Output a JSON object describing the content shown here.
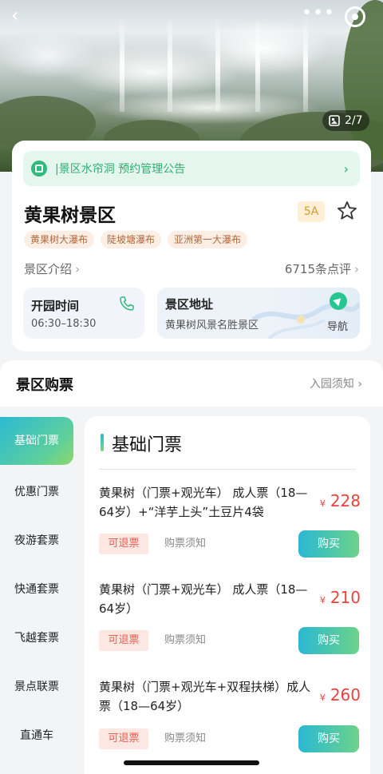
{
  "hero": {
    "photo_count": "2/7"
  },
  "info": {
    "notice": "|景区水帘洞 预约管理公告",
    "title": "黄果树景区",
    "level": "5A",
    "tags": [
      "黄果树大瀑布",
      "陡坡塘瀑布",
      "亚洲第一大瀑布"
    ],
    "intro_label": "景区介绍",
    "reviews_label": "6715条点评",
    "open_label": "开园时间",
    "open_hours": "06:30–18:30",
    "address_label": "景区地址",
    "address_value": "黄果树风景名胜景区",
    "nav_label": "导航"
  },
  "tickets_section": {
    "title": "景区购票",
    "entry_notice": "入园须知",
    "sidebar": [
      "基础门票",
      "优惠门票",
      "夜游套票",
      "快通套票",
      "飞越套票",
      "景点联票",
      "直通车"
    ],
    "active_index": 0,
    "category_title": "基础门票",
    "items": [
      {
        "name": "黄果树（门票+观光车） 成人票（18—64岁）+“洋芋上头”土豆片4袋",
        "currency": "¥",
        "price": "228",
        "refund": "可退票",
        "rules": "购票须知",
        "buy": "购买"
      },
      {
        "name": "黄果树（门票+观光车） 成人票（18—64岁）",
        "currency": "¥",
        "price": "210",
        "refund": "可退票",
        "rules": "购票须知",
        "buy": "购买"
      },
      {
        "name": "黄果树（门票+观光车+双程扶梯）成人票（18—64岁）",
        "currency": "¥",
        "price": "260",
        "refund": "可退票",
        "rules": "购票须知",
        "buy": "购买"
      }
    ]
  },
  "colors": {
    "accent_green": "#2fba7e",
    "price_red": "#e8433e",
    "gradient_start": "#2cb9d4",
    "gradient_end": "#8fd86a"
  }
}
